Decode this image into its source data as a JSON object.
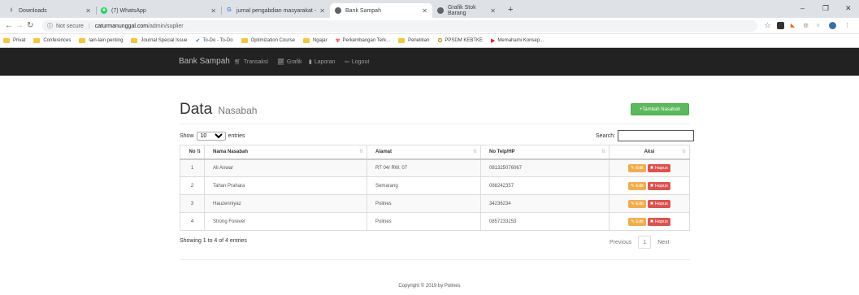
{
  "browser": {
    "tabs": [
      {
        "title": "Downloads",
        "icon": "download-icon",
        "active": false
      },
      {
        "title": "(7) WhatsApp",
        "icon": "whatsapp-icon",
        "active": false
      },
      {
        "title": "jurnal pengabdian masyarakat -",
        "icon": "google-icon",
        "active": false
      },
      {
        "title": "Bank Sampah",
        "icon": "globe-icon",
        "active": true
      },
      {
        "title": "Grafik Stok Barang",
        "icon": "globe-icon",
        "active": false
      }
    ],
    "address": {
      "security": "Not secure",
      "host": "caturmanunggal.com",
      "path": "/admin/suplier"
    },
    "bookmarks": [
      {
        "label": "Privat",
        "icon": "folder-icon"
      },
      {
        "label": "Conferences",
        "icon": "folder-icon"
      },
      {
        "label": "lain-lain penting",
        "icon": "folder-icon"
      },
      {
        "label": "Journal Special Issue",
        "icon": "folder-icon"
      },
      {
        "label": "To-Do - To-Do",
        "icon": "check-icon"
      },
      {
        "label": "Optimization Course",
        "icon": "folder-icon"
      },
      {
        "label": "Ngajar",
        "icon": "folder-icon"
      },
      {
        "label": "Perkembangan Terk...",
        "icon": "pinwheel-icon"
      },
      {
        "label": "Penelitian",
        "icon": "folder-icon"
      },
      {
        "label": "PPSDM KEBTKE",
        "icon": "emblem-icon"
      },
      {
        "label": "Memahami Konsep...",
        "icon": "youtube-icon"
      }
    ]
  },
  "navbar": {
    "brand": "Bank Sampah",
    "items": [
      "Transaksi",
      "Grafik",
      "Laporan",
      "Logout"
    ]
  },
  "main": {
    "title": "Data",
    "subtitle": "Nasabah",
    "add_button": "Tambah Nasabah",
    "show_label": "Show",
    "entries_value": "10",
    "entries_label": "entries",
    "search_label": "Search:",
    "columns": [
      "No",
      "Nama Nasabah",
      "Alamat",
      "No Telp/HP",
      "Aksi"
    ],
    "rows": [
      {
        "no": "1",
        "nama": "Ali Anwar",
        "alamat": "RT 04/ RW. 07",
        "telp": "081325076067"
      },
      {
        "no": "2",
        "nama": "Tahan Prahara",
        "alamat": "Semarang",
        "telp": "088242357"
      },
      {
        "no": "3",
        "nama": "Hauzenniyaz",
        "alamat": "Polines",
        "telp": "34236234"
      },
      {
        "no": "4",
        "nama": "Strong Forever",
        "alamat": "Polines",
        "telp": "0857233253"
      }
    ],
    "edit_label": "Edit",
    "delete_label": "Hapus",
    "info": "Showing 1 to 4 of 4 entries",
    "pager": {
      "previous": "Previous",
      "page": "1",
      "next": "Next"
    }
  },
  "footer": "Copyright © 2019 by Polines",
  "colors": {
    "navbar": "#222222",
    "add_button": "#5cb85c",
    "edit": "#f0ad4e",
    "delete": "#d9534f"
  }
}
